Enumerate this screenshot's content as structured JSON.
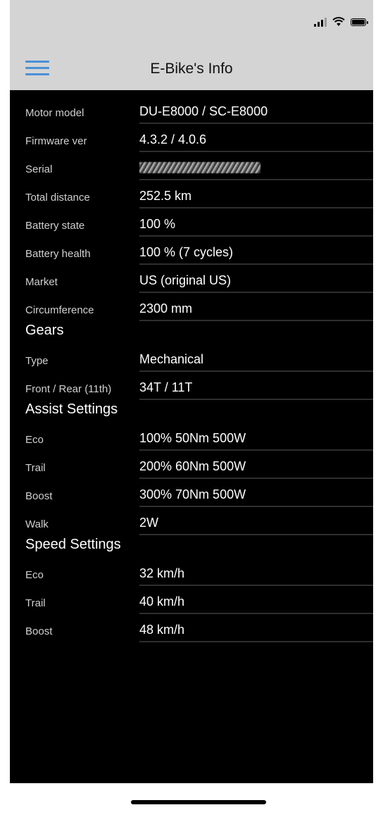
{
  "header": {
    "title": "E-Bike's Info"
  },
  "info": [
    {
      "label": "Motor model",
      "value": "DU-E8000 / SC-E8000"
    },
    {
      "label": "Firmware ver",
      "value": "4.3.2 / 4.0.6"
    },
    {
      "label": "Serial",
      "value": ""
    },
    {
      "label": "Total distance",
      "value": "252.5 km"
    },
    {
      "label": "Battery state",
      "value": "100 %"
    },
    {
      "label": "Battery health",
      "value": "100 % (7 cycles)"
    },
    {
      "label": "Market",
      "value": "US (original US)"
    },
    {
      "label": "Circumference",
      "value": "2300 mm"
    }
  ],
  "gears": {
    "title": "Gears",
    "rows": [
      {
        "label": "Type",
        "value": "Mechanical"
      },
      {
        "label": "Front / Rear (11th)",
        "value": "34T / 11T"
      }
    ]
  },
  "assist": {
    "title": "Assist Settings",
    "rows": [
      {
        "label": "Eco",
        "value": "100% 50Nm 500W"
      },
      {
        "label": "Trail",
        "value": "200% 60Nm 500W"
      },
      {
        "label": "Boost",
        "value": "300% 70Nm 500W"
      },
      {
        "label": "Walk",
        "value": "2W"
      }
    ]
  },
  "speed": {
    "title": "Speed Settings",
    "rows": [
      {
        "label": "Eco",
        "value": "32 km/h"
      },
      {
        "label": "Trail",
        "value": "40 km/h"
      },
      {
        "label": "Boost",
        "value": "48 km/h"
      }
    ]
  },
  "icons": {
    "menu": "hamburger-menu-icon",
    "signal": "cellular-signal-icon",
    "wifi": "wifi-icon",
    "battery": "battery-icon"
  },
  "colors": {
    "accent": "#4a90d9",
    "header_bg": "#d4d4d4",
    "content_bg": "#000000"
  }
}
